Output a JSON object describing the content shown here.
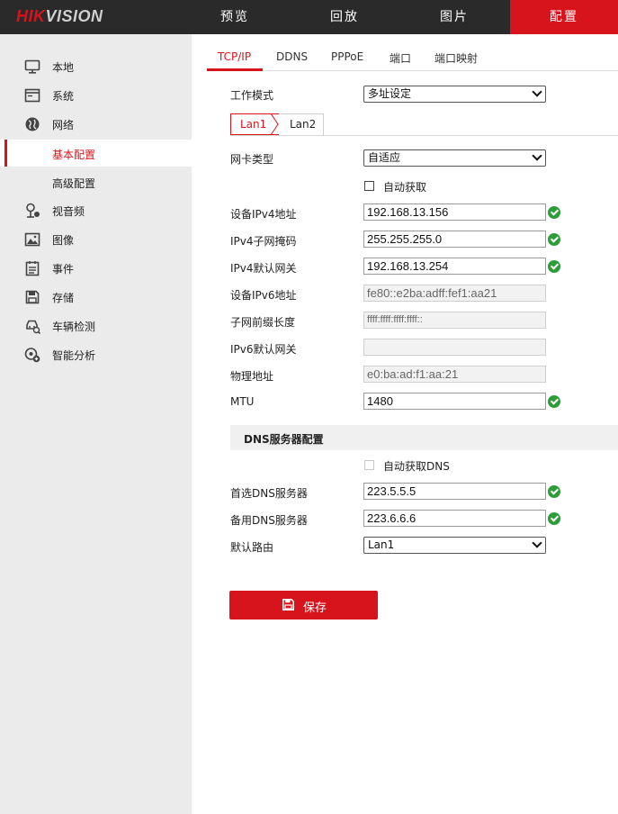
{
  "brand": {
    "logo_part1": "HIK",
    "logo_part2": "VISION"
  },
  "topnav": [
    {
      "label": "预览"
    },
    {
      "label": "回放"
    },
    {
      "label": "图片"
    },
    {
      "label": "配置",
      "active": true
    }
  ],
  "sidebar": {
    "items": [
      {
        "label": "本地",
        "icon": "monitor-icon"
      },
      {
        "label": "系统",
        "icon": "system-icon"
      },
      {
        "label": "网络",
        "icon": "globe-icon"
      },
      {
        "label": "视音频",
        "icon": "audio-video-icon"
      },
      {
        "label": "图像",
        "icon": "image-icon"
      },
      {
        "label": "事件",
        "icon": "event-icon"
      },
      {
        "label": "存储",
        "icon": "storage-icon"
      },
      {
        "label": "车辆检测",
        "icon": "vehicle-detection-icon"
      },
      {
        "label": "智能分析",
        "icon": "smart-analysis-icon"
      }
    ],
    "network_sub": [
      {
        "label": "基本配置",
        "active": true
      },
      {
        "label": "高级配置"
      }
    ]
  },
  "tabs": [
    {
      "label": "TCP/IP",
      "active": true
    },
    {
      "label": "DDNS"
    },
    {
      "label": "PPPoE"
    },
    {
      "label": "端口"
    },
    {
      "label": "端口映射"
    }
  ],
  "form": {
    "work_mode": {
      "label": "工作模式",
      "value": "多址设定"
    },
    "lan_tabs": [
      "Lan1",
      "Lan2"
    ],
    "nic_type": {
      "label": "网卡类型",
      "value": "自适应"
    },
    "auto_get": {
      "label": "自动获取",
      "checked": false
    },
    "ipv4_addr": {
      "label": "设备IPv4地址",
      "value": "192.168.13.156"
    },
    "ipv4_mask": {
      "label": "IPv4子网掩码",
      "value": "255.255.255.0"
    },
    "ipv4_gateway": {
      "label": "IPv4默认网关",
      "value": "192.168.13.254"
    },
    "ipv6_addr": {
      "label": "设备IPv6地址",
      "value": "fe80::e2ba:adff:fef1:aa21"
    },
    "prefix_len": {
      "label": "子网前缀长度",
      "value": "ffff:ffff:ffff:ffff::"
    },
    "ipv6_gateway": {
      "label": "IPv6默认网关",
      "value": ""
    },
    "mac": {
      "label": "物理地址",
      "value": "e0:ba:ad:f1:aa:21"
    },
    "mtu": {
      "label": "MTU",
      "value": "1480"
    }
  },
  "dns": {
    "section_title": "DNS服务器配置",
    "auto_dns": {
      "label": "自动获取DNS",
      "checked": false
    },
    "primary": {
      "label": "首选DNS服务器",
      "value": "223.5.5.5"
    },
    "secondary": {
      "label": "备用DNS服务器",
      "value": "223.6.6.6"
    },
    "default_route": {
      "label": "默认路由",
      "value": "Lan1"
    }
  },
  "save_button": {
    "label": "保存"
  },
  "colors": {
    "accent": "#d7141c",
    "topbar": "#2a2a2a",
    "sidebar": "#ebebeb",
    "ok": "#2d9d3a"
  }
}
